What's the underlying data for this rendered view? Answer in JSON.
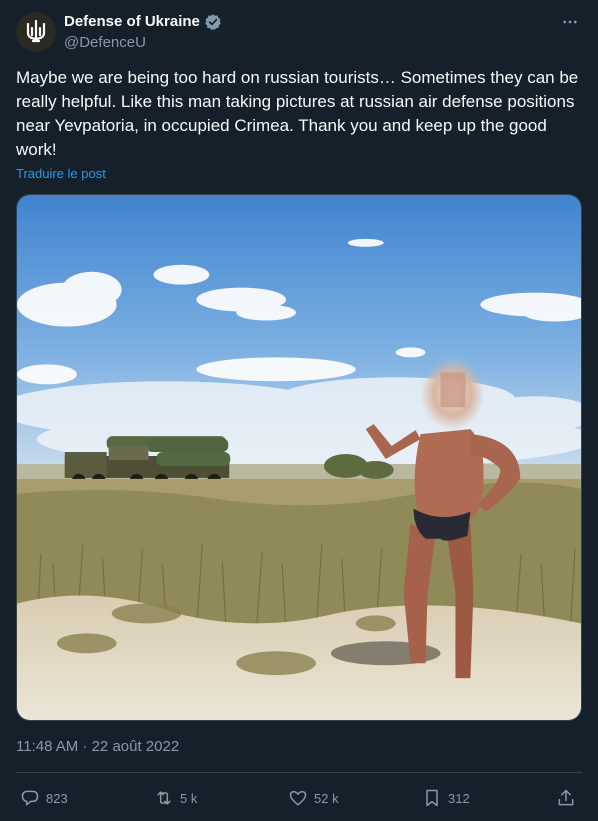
{
  "author": {
    "name": "Defense of Ukraine",
    "handle": "@DefenceU",
    "verified": true,
    "avatar_icon": "trident-icon"
  },
  "post": {
    "text": "Maybe we are being too hard on russian tourists… Sometimes they can be really helpful. Like this man taking pictures at russian air defense positions near Yevpatoria, in occupied Crimea. Thank you and keep up the good work!",
    "translate_label": "Traduire le post",
    "timestamp": "11:48 AM · 22 août 2022"
  },
  "actions": {
    "replies": "823",
    "reposts": "5 k",
    "likes": "52 k",
    "bookmarks": "312"
  },
  "colors": {
    "background": "#15202b",
    "text": "#f7f9f9",
    "muted": "#8b98a5",
    "accent": "#1d9bf0",
    "border": "#38444d"
  }
}
